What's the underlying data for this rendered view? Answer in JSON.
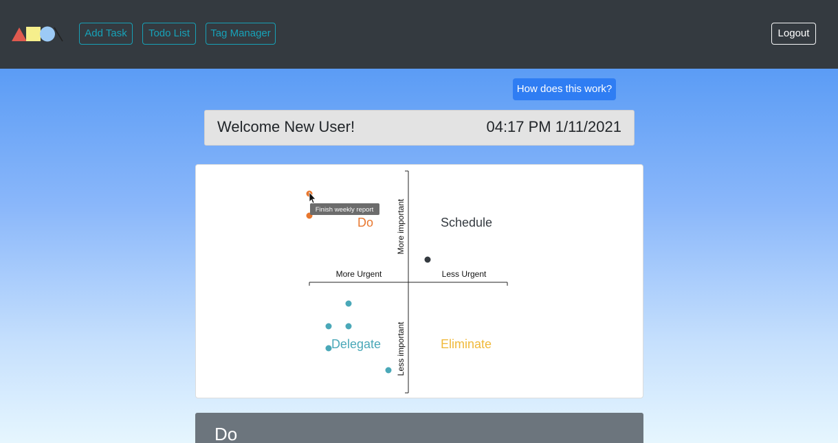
{
  "navbar": {
    "logo_icon": "shapes-logo-icon",
    "add_task_label": "Add Task",
    "todo_list_label": "Todo List",
    "tag_manager_label": "Tag Manager",
    "logout_label": "Logout"
  },
  "help": {
    "how_label": "How does this work?"
  },
  "welcome": {
    "greeting": "Welcome New User!",
    "datetime": "04:17 PM 1/11/2021"
  },
  "matrix": {
    "y_top_label": "More important",
    "y_bottom_label": "Less important",
    "x_left_label": "More Urgent",
    "x_right_label": "Less Urgent",
    "quadrants": {
      "do": {
        "label": "Do",
        "color": "#e8772e"
      },
      "schedule": {
        "label": "Schedule",
        "color": "#343a40"
      },
      "delegate": {
        "label": "Delegate",
        "color": "#4aa8b8"
      },
      "eliminate": {
        "label": "Eliminate",
        "color": "#f0b93a"
      }
    },
    "tooltip": "Finish weekly report"
  },
  "section": {
    "title": "Do"
  },
  "colors": {
    "navbar": "#343a40",
    "nav_outline": "#17a2b8",
    "primary": "#2f7df3"
  }
}
